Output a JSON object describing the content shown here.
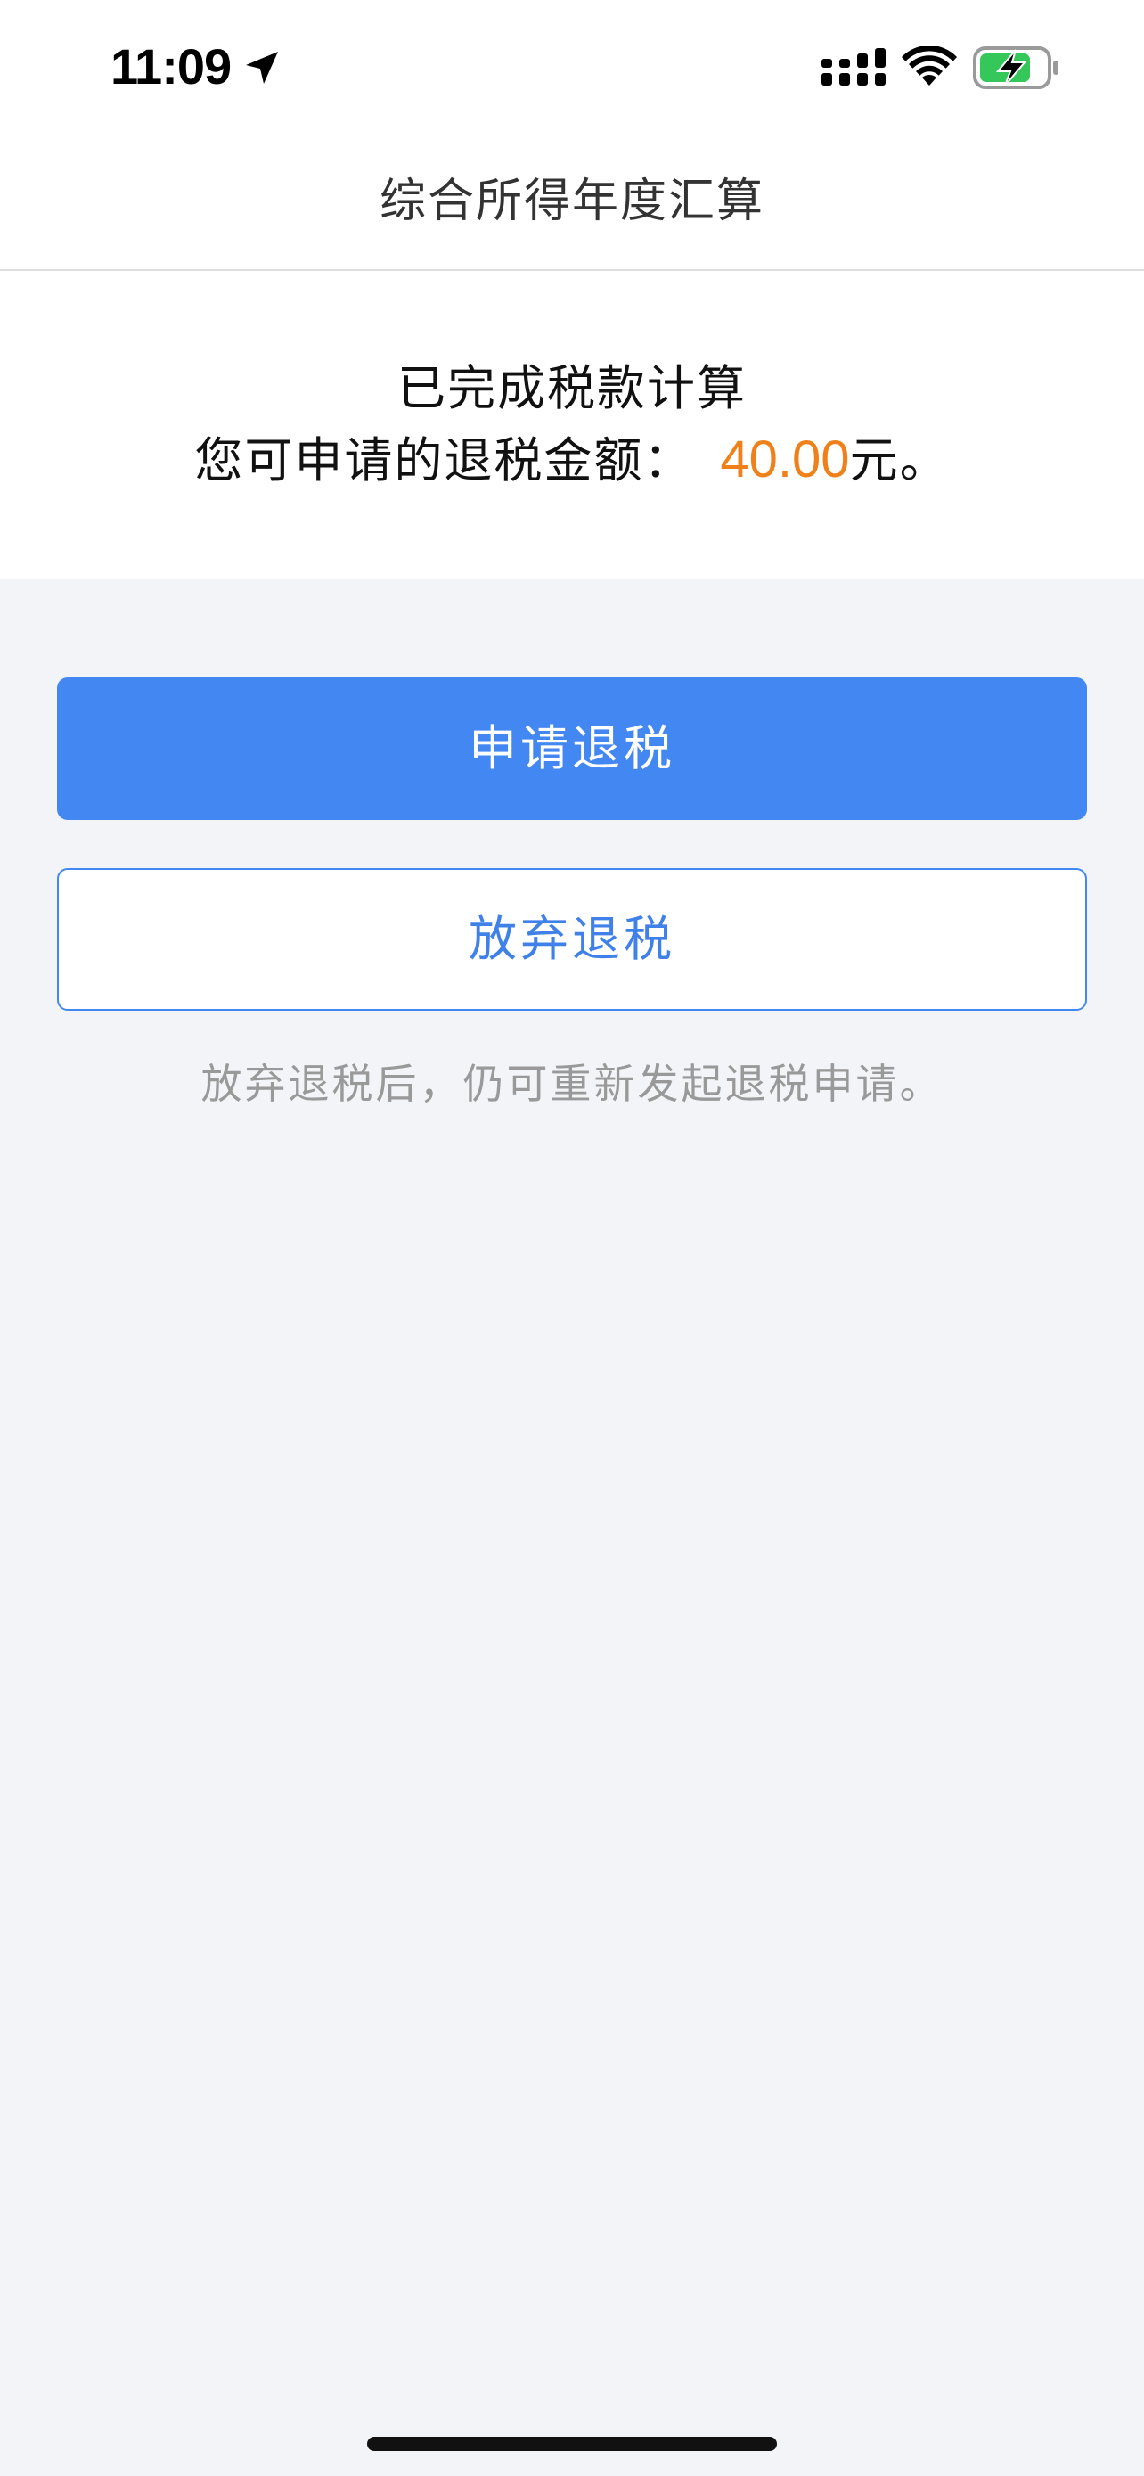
{
  "status_bar": {
    "time": "11:09",
    "icons": [
      "location-arrow-icon",
      "signal-icon",
      "wifi-icon",
      "battery-charging-icon"
    ]
  },
  "nav": {
    "title": "综合所得年度汇算"
  },
  "summary": {
    "line1": "已完成税款计算",
    "line2_prefix": "您可申请的退税金额：",
    "amount": "40.00",
    "line2_suffix": "元。"
  },
  "actions": {
    "apply_label": "申请退税",
    "abandon_label": "放弃退税"
  },
  "hint": "放弃退税后，仍可重新发起退税申请。",
  "colors": {
    "primary": "#4387f3",
    "amount": "#f08019",
    "background": "#f2f4f8",
    "hint": "#999999"
  }
}
